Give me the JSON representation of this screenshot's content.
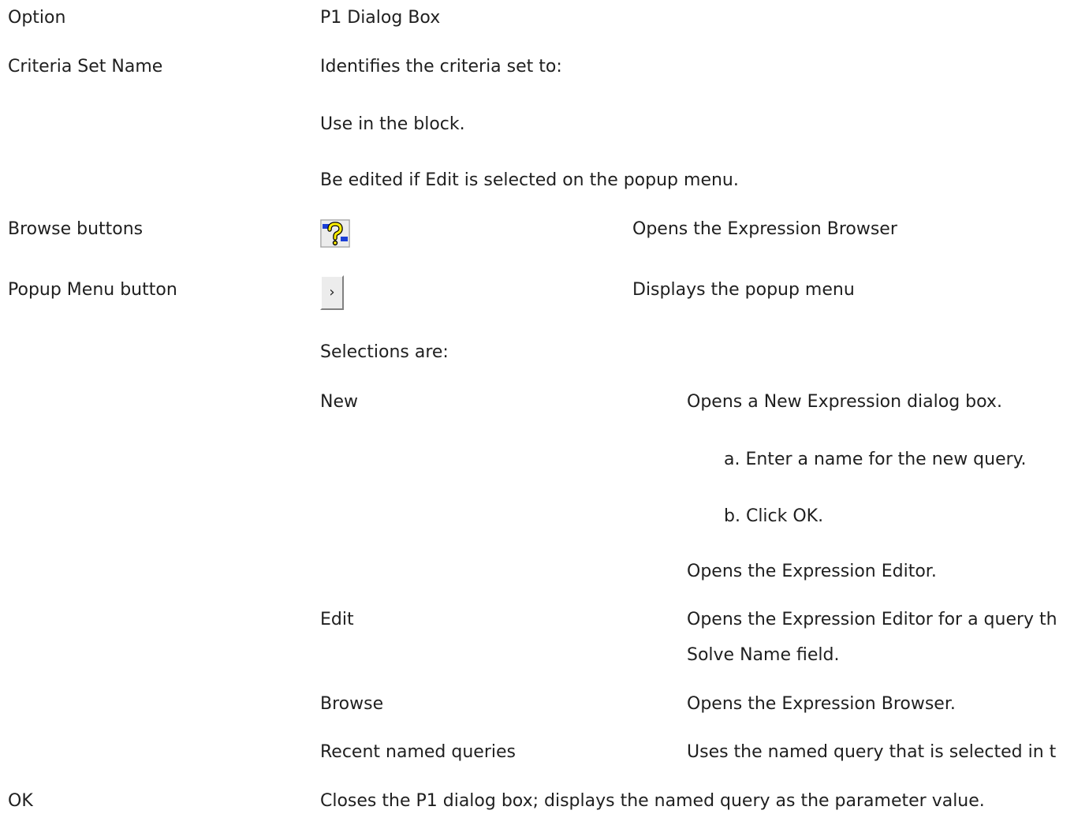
{
  "header": {
    "option": "Option",
    "dialog": "P1 Dialog Box"
  },
  "criteria": {
    "label": "Criteria Set Name",
    "intro": "Identifies the criteria set to:",
    "use": "Use in the block.",
    "edit": "Be edited if Edit is selected on the popup menu."
  },
  "browse": {
    "label": "Browse buttons",
    "icon": "expression-browser-icon",
    "desc": "Opens the Expression Browser"
  },
  "popup": {
    "label": "Popup Menu button",
    "icon": "chevron-right-icon",
    "glyph": "›",
    "desc": "Displays the popup menu",
    "selections_label": "Selections are:"
  },
  "selections": {
    "new": {
      "label": "New",
      "desc": "Opens a New Expression dialog box.",
      "step_a": "a. Enter a name for the new query.",
      "step_b": "b. Click OK.",
      "then": "Opens the Expression Editor."
    },
    "edit": {
      "label": "Edit",
      "desc_1": "Opens the Expression Editor for a query th",
      "desc_2": "Solve Name field."
    },
    "browse": {
      "label": "Browse",
      "desc": "Opens the Expression Browser."
    },
    "recent": {
      "label": "Recent named queries",
      "desc": "Uses the named query that is selected in t"
    }
  },
  "ok": {
    "label": "OK",
    "desc": "Closes the P1 dialog box; displays the named query as the parameter value."
  }
}
